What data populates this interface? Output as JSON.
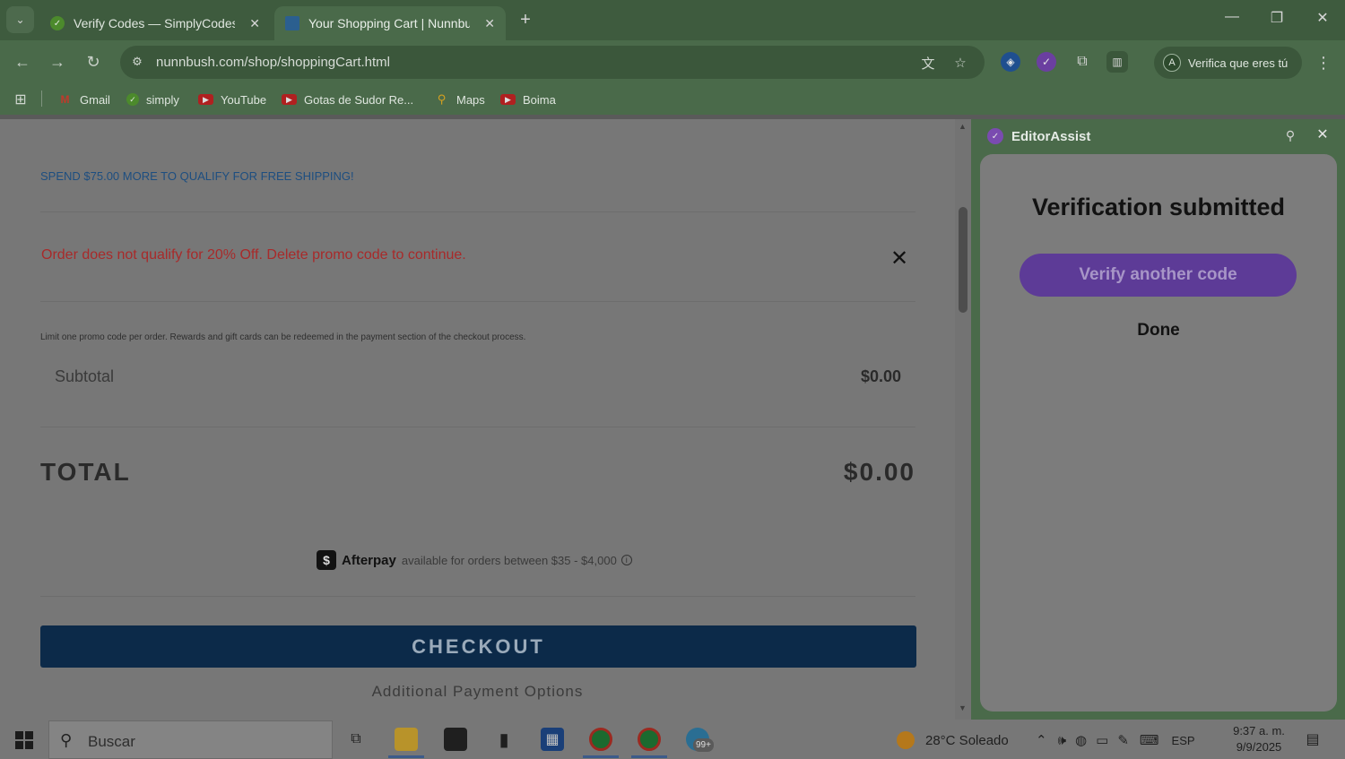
{
  "browser": {
    "tabs": [
      {
        "title": "Verify Codes — SimplyCodes",
        "close": "✕"
      },
      {
        "title": "Your Shopping Cart | Nunnbush",
        "close": "✕"
      }
    ],
    "new_tab": "+",
    "window_controls": {
      "minimize": "—",
      "maximize": "❐",
      "close": "✕"
    },
    "url": "nunnbush.com/shop/shoppingCart.html",
    "profile_label": "Verifica que eres tú",
    "profile_initial": "A",
    "bookmarks": [
      {
        "label": "Gmail",
        "icon": "gmail-icon"
      },
      {
        "label": "simply",
        "icon": "simplycodes-icon"
      },
      {
        "label": "YouTube",
        "icon": "youtube-icon"
      },
      {
        "label": "Gotas de Sudor Re...",
        "icon": "youtube-icon"
      },
      {
        "label": "Maps",
        "icon": "maps-icon"
      },
      {
        "label": "Boima",
        "icon": "youtube-icon"
      }
    ]
  },
  "cart": {
    "shipping_notice": "SPEND $75.00 MORE TO QUALIFY FOR FREE SHIPPING!",
    "promo_error": "Order does not qualify for 20% Off. Delete promo code to continue.",
    "promo_remove": "✕",
    "limit_note": "Limit one promo code per order. Rewards and gift cards can be redeemed in the payment section of the checkout process.",
    "subtotal_label": "Subtotal",
    "subtotal_value": "$0.00",
    "total_label": "TOTAL",
    "total_value": "$0.00",
    "afterpay": {
      "logo": "$",
      "name": "Afterpay",
      "text": "available for orders between $35 - $4,000",
      "info": "i"
    },
    "checkout_label": "CHECKOUT",
    "additional_payment": "Additional Payment Options"
  },
  "side_panel": {
    "title": "EditorAssist",
    "card_title": "Verification submitted",
    "verify_another": "Verify another code",
    "done": "Done"
  },
  "taskbar": {
    "search_placeholder": "Buscar",
    "weather": "28°C  Soleado",
    "language": "ESP",
    "time": "9:37 a. m.",
    "date": "9/9/2025",
    "badge_count": "99+"
  }
}
